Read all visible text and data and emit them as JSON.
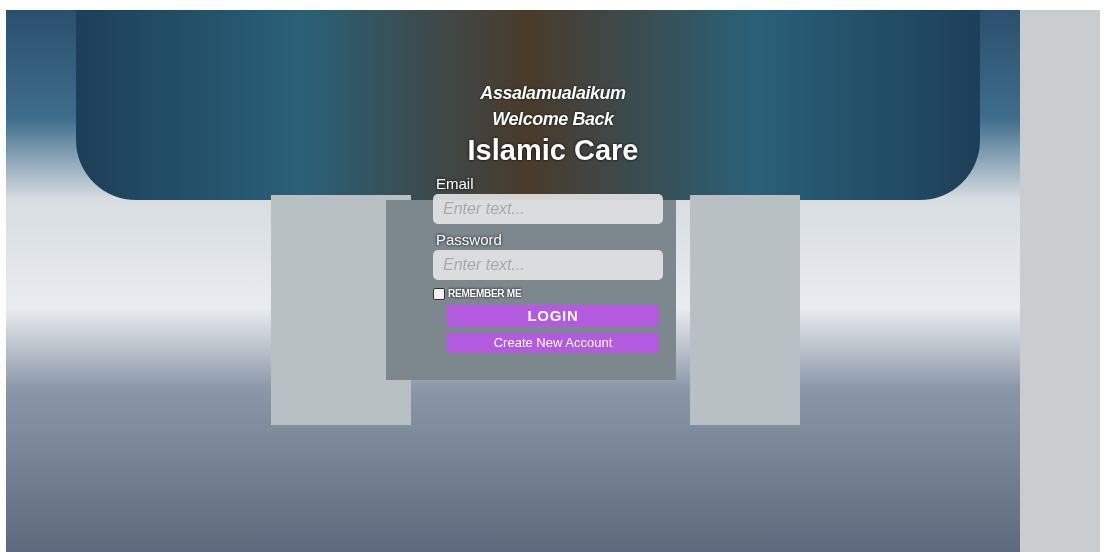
{
  "greeting": "Assalamualaikum",
  "subtitle": "Welcome Back",
  "app_title": "Islamic Care",
  "fields": [
    {
      "label": "Email",
      "placeholder": "Enter text..."
    },
    {
      "label": "Password",
      "placeholder": "Enter text..."
    }
  ],
  "remember_me": {
    "label": "REMEMBER ME",
    "checked": false
  },
  "buttons": [
    "LOGIN",
    "Create New Account"
  ]
}
